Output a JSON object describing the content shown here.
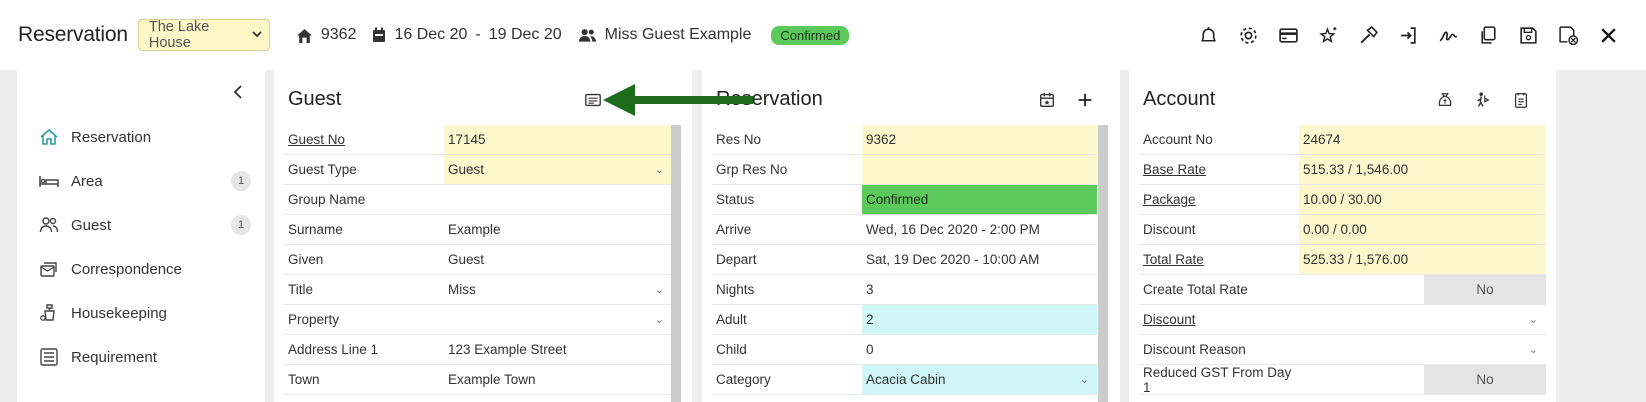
{
  "header": {
    "title": "Reservation",
    "property": "The Lake House",
    "res_no": "9362",
    "date_from": "16 Dec 20",
    "date_sep": "-",
    "date_to": "19 Dec 20",
    "guest_name": "Miss Guest Example",
    "status": "Confirmed",
    "status_color": "#5cc95c",
    "toolbar_icons": [
      "bell-icon",
      "gear-icon",
      "credit-card-icon",
      "sparkle-star-icon",
      "hammer-icon",
      "sign-in-icon",
      "signature-icon",
      "copy-icon",
      "save-icon",
      "save-cancel-icon",
      "close-icon"
    ]
  },
  "nav": {
    "items": [
      {
        "label": "Reservation",
        "icon": "home-icon",
        "active": true,
        "count": ""
      },
      {
        "label": "Area",
        "icon": "bed-icon",
        "active": false,
        "count": "1"
      },
      {
        "label": "Guest",
        "icon": "users-icon",
        "active": false,
        "count": "1"
      },
      {
        "label": "Correspondence",
        "icon": "mail-stack-icon",
        "active": false,
        "count": ""
      },
      {
        "label": "Housekeeping",
        "icon": "housekeeping-icon",
        "active": false,
        "count": ""
      },
      {
        "label": "Requirement",
        "icon": "list-icon",
        "active": false,
        "count": ""
      }
    ]
  },
  "guest": {
    "title": "Guest",
    "rows": [
      {
        "label": "Guest No",
        "value": "17145"
      },
      {
        "label": "Guest Type",
        "value": "Guest"
      },
      {
        "label": "Group Name",
        "value": ""
      },
      {
        "label": "Surname",
        "value": "Example"
      },
      {
        "label": "Given",
        "value": "Guest"
      },
      {
        "label": "Title",
        "value": "Miss"
      },
      {
        "label": "Property",
        "value": ""
      },
      {
        "label": "Address Line 1",
        "value": "123 Example Street"
      },
      {
        "label": "Town",
        "value": "Example Town"
      }
    ]
  },
  "reservation": {
    "title": "Reservation",
    "rows": [
      {
        "label": "Res No",
        "value": "9362"
      },
      {
        "label": "Grp Res No",
        "value": ""
      },
      {
        "label": "Status",
        "value": "Confirmed"
      },
      {
        "label": "Arrive",
        "value": "Wed, 16 Dec 2020 - 2:00 PM"
      },
      {
        "label": "Depart",
        "value": "Sat, 19 Dec 2020 - 10:00 AM"
      },
      {
        "label": "Nights",
        "value": "3"
      },
      {
        "label": "Adult",
        "value": "2"
      },
      {
        "label": "Child",
        "value": "0"
      },
      {
        "label": "Category",
        "value": "Acacia Cabin"
      }
    ]
  },
  "account": {
    "title": "Account",
    "rows": [
      {
        "label": "Account No",
        "value": "24674"
      },
      {
        "label": "Base Rate",
        "value": "515.33 / 1,546.00"
      },
      {
        "label": "Package",
        "value": "10.00 / 30.00"
      },
      {
        "label": "Discount",
        "value": "0.00 / 0.00"
      },
      {
        "label": "Total Rate",
        "value": "525.33 / 1,576.00"
      },
      {
        "label": "Create Total Rate",
        "value": "No"
      },
      {
        "label": "Discount",
        "value": ""
      },
      {
        "label": "Discount Reason",
        "value": ""
      },
      {
        "label": "Reduced GST From Day 1",
        "value": "No"
      }
    ]
  },
  "colors": {
    "accent": "#2aa0a6",
    "yellow_field": "#fcf7cd",
    "cyan_field": "#cff6f9",
    "arrow": "#1d6b1d"
  }
}
